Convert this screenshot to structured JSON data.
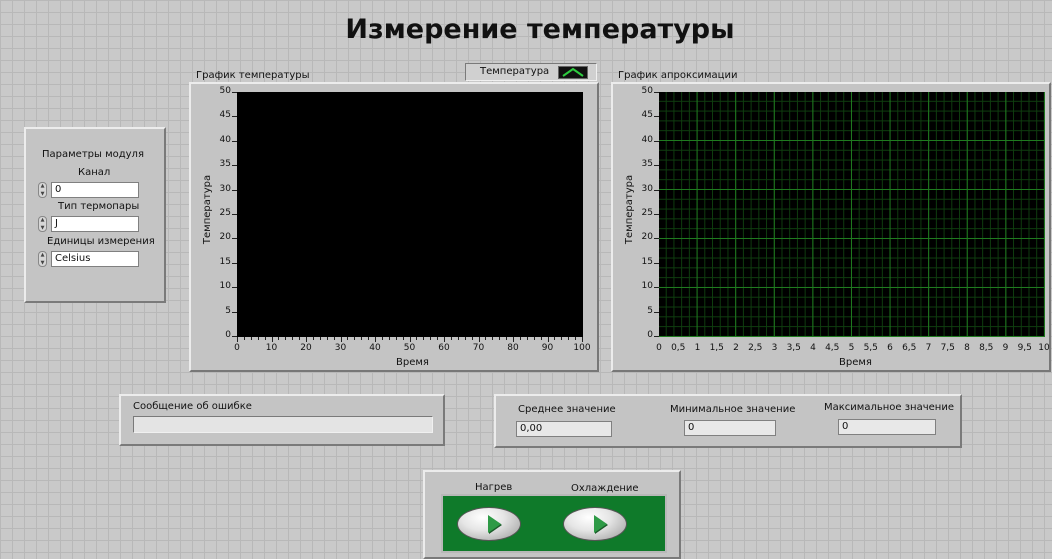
{
  "title": "Измерение температуры",
  "module_params": {
    "heading": "Параметры модуля",
    "channel_label": "Канал",
    "channel_value": "0",
    "thermocouple_label": "Тип термопары",
    "thermocouple_value": "J",
    "units_label": "Единицы измерения",
    "units_value": "Celsius"
  },
  "temperature_graph": {
    "title": "График температуры",
    "legend_label": "Температура",
    "ylabel": "Температура",
    "xlabel": "Время",
    "y_ticks": [
      "50",
      "45",
      "40",
      "35",
      "30",
      "25",
      "20",
      "15",
      "10",
      "5",
      "0"
    ],
    "x_ticks": [
      "0",
      "10",
      "20",
      "30",
      "40",
      "50",
      "60",
      "70",
      "80",
      "90",
      "100"
    ]
  },
  "approx_graph": {
    "title": "График апроксимации",
    "ylabel": "Температура",
    "xlabel": "Время",
    "y_ticks": [
      "50",
      "45",
      "40",
      "35",
      "30",
      "25",
      "20",
      "15",
      "10",
      "5",
      "0"
    ],
    "x_ticks": [
      "0",
      "0,5",
      "1",
      "1,5",
      "2",
      "2,5",
      "3",
      "3,5",
      "4",
      "4,5",
      "5",
      "5,5",
      "6",
      "6,5",
      "7",
      "7,5",
      "8",
      "8,5",
      "9",
      "9,5",
      "10"
    ]
  },
  "error": {
    "label": "Сообщение об ошибке",
    "value": ""
  },
  "stats": {
    "mean_label": "Среднее значение",
    "mean_value": "0,00",
    "min_label": "Минимальное значение",
    "min_value": "0",
    "max_label": "Максимальное значение",
    "max_value": "0"
  },
  "controls": {
    "heat_label": "Нагрев",
    "cool_label": "Охлаждение"
  },
  "colors": {
    "plot_background": "#000000",
    "grid_green": "#1f7a1f",
    "button_panel": "#0f7a2a",
    "legend_icon": "#2ecc40"
  }
}
